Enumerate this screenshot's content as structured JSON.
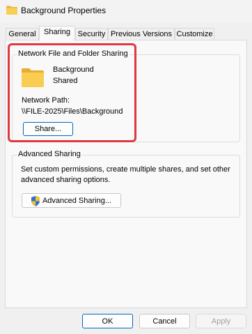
{
  "window": {
    "title": "Background Properties"
  },
  "tabs": [
    {
      "label": "General"
    },
    {
      "label": "Sharing"
    },
    {
      "label": "Security"
    },
    {
      "label": "Previous Versions"
    },
    {
      "label": "Customize"
    }
  ],
  "network_sharing": {
    "legend": "Network File and Folder Sharing",
    "folder_name": "Background",
    "folder_status": "Shared",
    "path_label": "Network Path:",
    "path_value": "\\\\FILE-2025\\Files\\Background",
    "share_button": "Share..."
  },
  "advanced_sharing": {
    "legend": "Advanced Sharing",
    "description_line1": "Set custom permissions, create multiple shares, and set other",
    "description_line2": "advanced sharing options.",
    "button": "Advanced Sharing..."
  },
  "footer": {
    "ok": "OK",
    "cancel": "Cancel",
    "apply": "Apply"
  },
  "colors": {
    "highlight": "#e0383e",
    "accent": "#0067c0",
    "folder": "#f6c94a"
  }
}
